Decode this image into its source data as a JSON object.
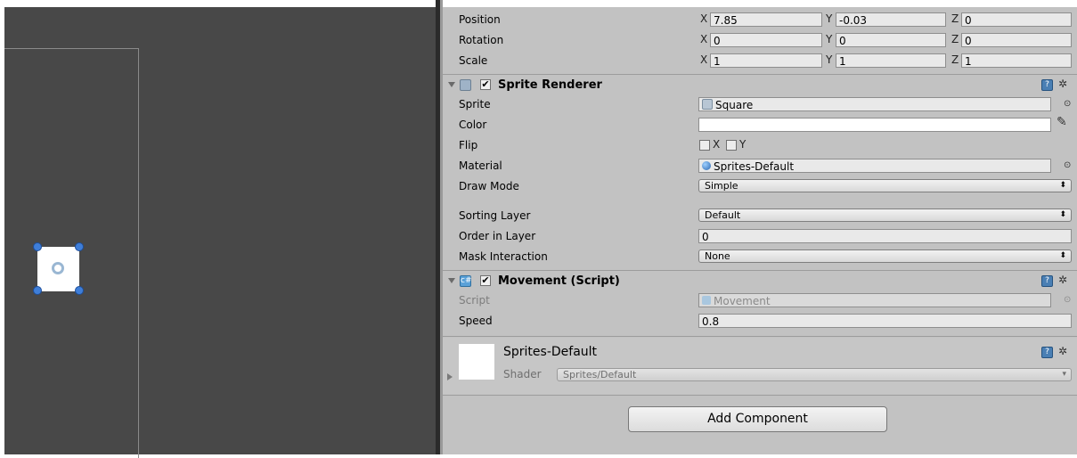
{
  "transform": {
    "position": {
      "label": "Position",
      "x": "7.85",
      "y": "-0.03",
      "z": "0"
    },
    "rotation": {
      "label": "Rotation",
      "x": "0",
      "y": "0",
      "z": "0"
    },
    "scale": {
      "label": "Scale",
      "x": "1",
      "y": "1",
      "z": "1"
    },
    "axis_x": "X",
    "axis_y": "Y",
    "axis_z": "Z"
  },
  "sprite_renderer": {
    "title": "Sprite Renderer",
    "enabled": true,
    "sprite_label": "Sprite",
    "sprite_value": "Square",
    "color_label": "Color",
    "flip_label": "Flip",
    "flip_x": "X",
    "flip_y": "Y",
    "material_label": "Material",
    "material_value": "Sprites-Default",
    "draw_mode_label": "Draw Mode",
    "draw_mode_value": "Simple",
    "sorting_layer_label": "Sorting Layer",
    "sorting_layer_value": "Default",
    "order_label": "Order in Layer",
    "order_value": "0",
    "mask_label": "Mask Interaction",
    "mask_value": "None"
  },
  "movement": {
    "title": "Movement (Script)",
    "enabled": true,
    "script_label": "Script",
    "script_value": "Movement",
    "speed_label": "Speed",
    "speed_value": "0.8"
  },
  "material": {
    "name": "Sprites-Default",
    "shader_label": "Shader",
    "shader_value": "Sprites/Default"
  },
  "add_component_label": "Add Component",
  "colors": {
    "inspector_bg": "#c2c2c2",
    "scene_bg": "#484848",
    "handle": "#3f7ed8"
  }
}
